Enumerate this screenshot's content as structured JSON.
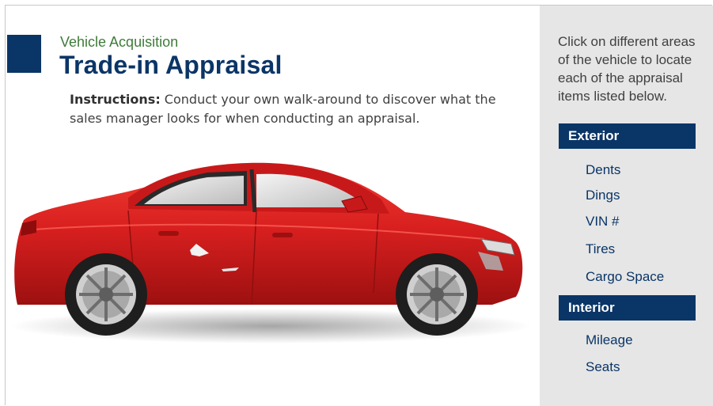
{
  "header": {
    "subtitle": "Vehicle Acquisition",
    "title": "Trade-in Appraisal"
  },
  "instructions": {
    "label": "Instructions:",
    "text": " Conduct your own walk-around to discover what the sales manager looks for when conducting an appraisal."
  },
  "sidebar": {
    "intro": "Click on different areas of the vehicle to locate each of the appraisal items listed below.",
    "sections": [
      {
        "label": "Exterior",
        "items": [
          "Dents",
          "Dings",
          "VIN #",
          "Tires",
          "Cargo Space"
        ]
      },
      {
        "label": "Interior",
        "items": [
          "Mileage",
          "Seats"
        ]
      }
    ]
  },
  "colors": {
    "brand_navy": "#0a3567",
    "subtitle_green": "#3f7b3a",
    "sidebar_bg": "#e6e6e6",
    "car_red": "#d81f1f"
  }
}
